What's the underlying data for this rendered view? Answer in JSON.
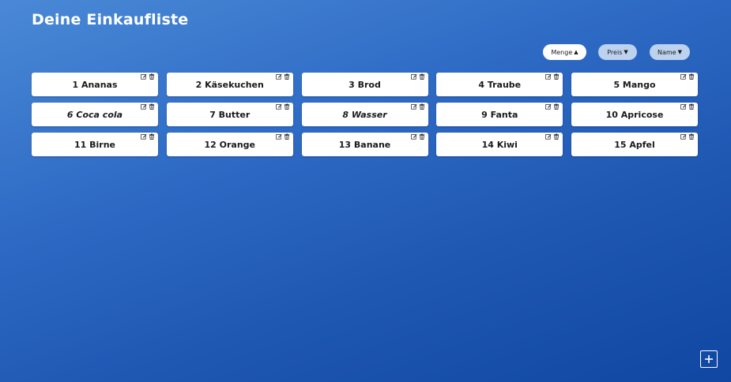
{
  "header": {
    "title": "Deine Einkaufliste"
  },
  "sort": {
    "buttons": [
      {
        "label": "Menge",
        "state": "active",
        "direction": "up"
      },
      {
        "label": "Preis",
        "state": "inactive",
        "direction": "down"
      },
      {
        "label": "Name",
        "state": "inactive",
        "direction": "down"
      }
    ]
  },
  "items": [
    {
      "label": "1 Ananas"
    },
    {
      "label": "2 Käsekuchen"
    },
    {
      "label": "3 Brod"
    },
    {
      "label": "4 Traube"
    },
    {
      "label": "5 Mango"
    },
    {
      "label": "6 Coca cola"
    },
    {
      "label": "7 Butter"
    },
    {
      "label": "8 Wasser"
    },
    {
      "label": "9 Fanta"
    },
    {
      "label": "10 Apricose"
    },
    {
      "label": "11 Birne"
    },
    {
      "label": "12 Orange"
    },
    {
      "label": "13 Banane"
    },
    {
      "label": "14 Kiwi"
    },
    {
      "label": "15 Apfel"
    }
  ],
  "icons": {
    "edit": "edit-icon",
    "delete": "trash-icon",
    "add": "plus-icon",
    "sort_up": "caret-up-icon",
    "sort_down": "caret-down-icon"
  },
  "colors": {
    "background_top": "#4a89d6",
    "background_bottom": "#0f47a3",
    "card": "#ffffff",
    "sort_active": "#ffffff",
    "sort_inactive": "#bcd2ee",
    "text_dark": "#1a1a1a"
  }
}
